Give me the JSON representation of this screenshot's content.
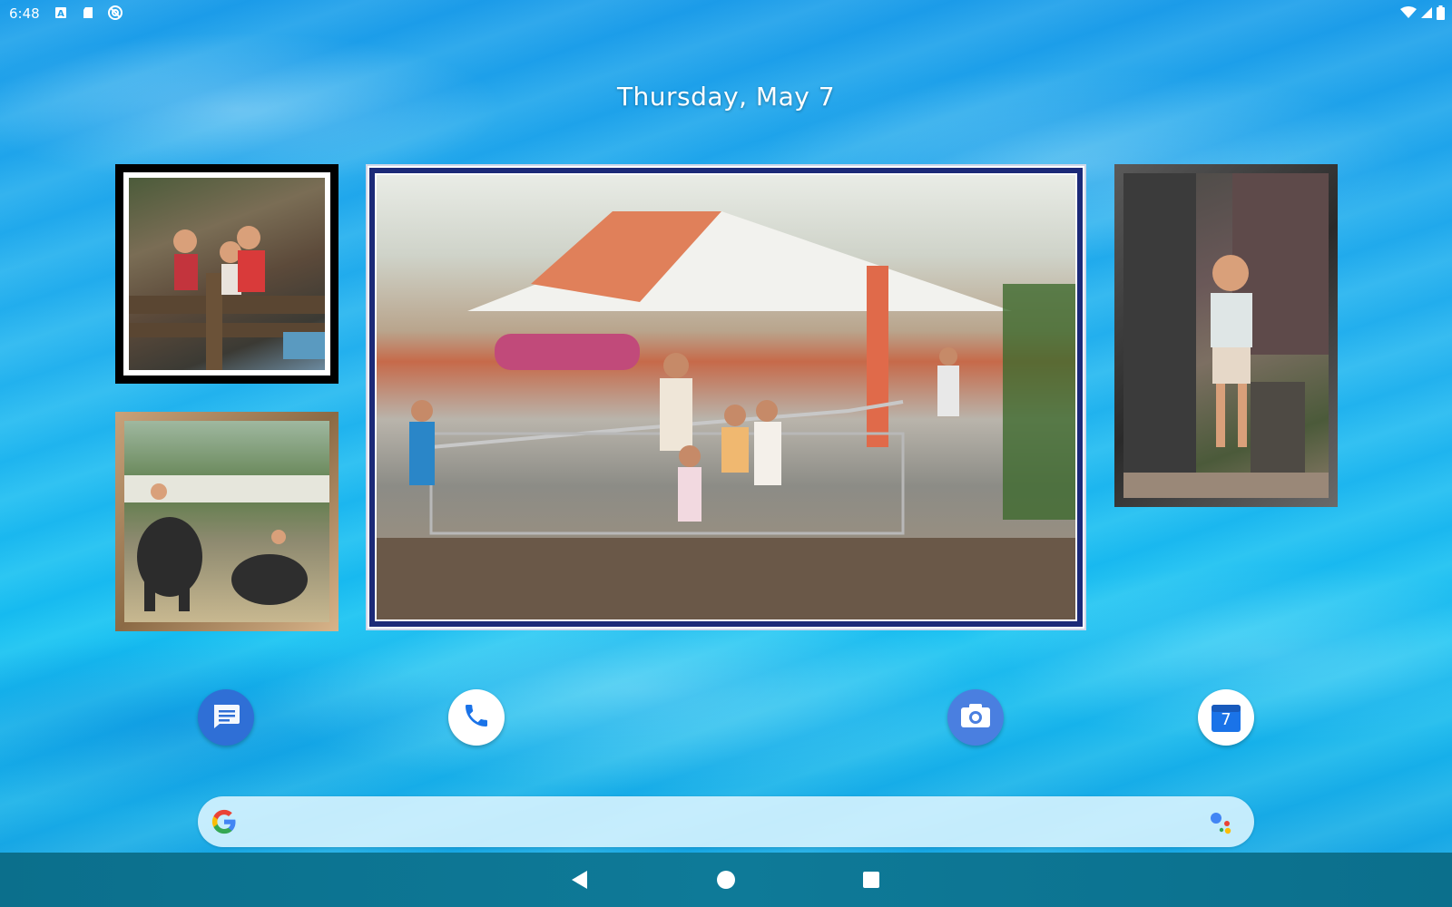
{
  "status_bar": {
    "time": "6:48",
    "left_icons": [
      "text-a-icon",
      "sd-card-icon",
      "sync-icon"
    ],
    "right_icons": [
      "wifi-icon",
      "cell-signal-icon",
      "battery-icon"
    ]
  },
  "home": {
    "date": "Thursday, May 7"
  },
  "photo_widgets": [
    {
      "name": "photo-frame-black",
      "frame_color": "#000000"
    },
    {
      "name": "photo-frame-wood",
      "frame_color": "#b08a60"
    },
    {
      "name": "photo-frame-navy",
      "frame_color": "#1c2a78"
    },
    {
      "name": "photo-frame-dark",
      "frame_color": "#3a3a3a"
    }
  ],
  "dock": {
    "apps": [
      {
        "name": "Messages",
        "icon": "messages-icon",
        "color": "#2f6fd6"
      },
      {
        "name": "Phone",
        "icon": "phone-icon",
        "color": "#1a73e8"
      },
      {
        "name": "Camera",
        "icon": "camera-icon",
        "color": "#4a7fe0"
      },
      {
        "name": "Calendar",
        "icon": "calendar-icon",
        "color": "#1a73e8",
        "badge": "7"
      }
    ]
  },
  "search": {
    "placeholder": "",
    "logo_icon": "google-g-icon",
    "assistant_icon": "google-assistant-icon"
  },
  "navigation": {
    "buttons": [
      "back-icon",
      "home-icon",
      "recents-icon"
    ]
  },
  "colors": {
    "accent_blue": "#1a73e8",
    "nav_bar": "#0e7a98"
  }
}
